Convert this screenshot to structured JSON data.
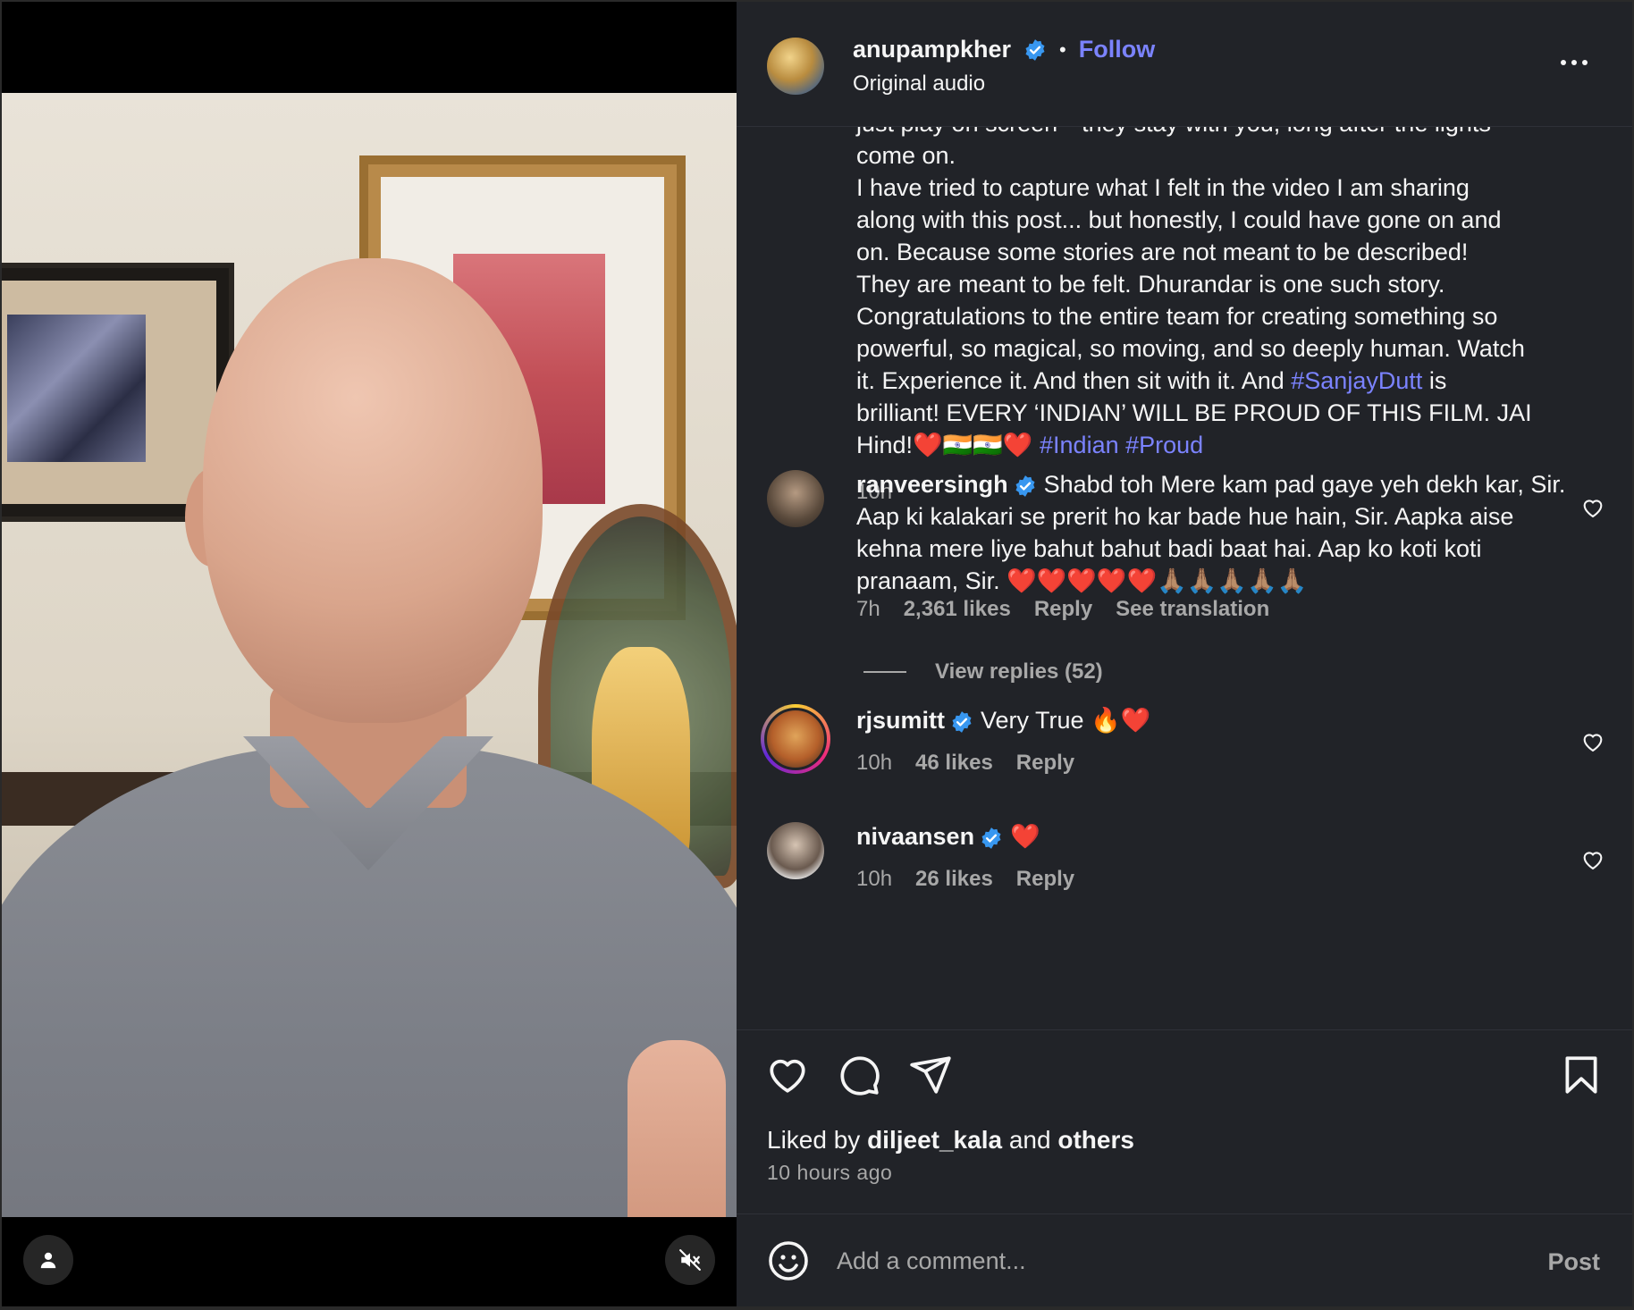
{
  "post": {
    "author": "anupampkher",
    "follow_label": "Follow",
    "separator": "•",
    "audio": "Original audio",
    "caption_lines": [
      "just play on screen—they stay with you, long after the lights",
      "come on.",
      "I have tried to capture what I felt in the video I am sharing",
      "along with this post... but honestly, I could have gone on and",
      "on. Because some stories are not meant to be described!",
      "They are meant to be felt. Dhurandar is one such story.",
      "Congratulations to the entire team for creating something so",
      "powerful, so magical, so moving, and so deeply human. Watch"
    ],
    "caption_line_9_pre": "it. Experience it. And then sit with it. And ",
    "caption_hashtag_1": "#SanjayDutt",
    "caption_line_9_post": " is",
    "caption_line_10": "brilliant! EVERY ‘INDIAN’ WILL BE PROUD OF THIS FILM. JAI",
    "caption_line_11_pre": "Hind!❤️🇮🇳🇮🇳❤️ ",
    "caption_hashtag_2": "#Indian",
    "caption_hashtag_3": "#Proud",
    "caption_time": "10h"
  },
  "comments": [
    {
      "username": "ranveersingh",
      "text": "Shabd toh Mere kam pad gaye yeh dekh kar, Sir. Aap ki kalakari se prerit ho kar bade hue hain, Sir. Aapka aise kehna mere liye bahut bahut badi baat hai. Aap ko koti koti pranaam, Sir. ❤️❤️❤️❤️❤️🙏🏽🙏🏽🙏🏽🙏🏽🙏🏽",
      "time": "7h",
      "likes": "2,361 likes",
      "reply": "Reply",
      "see_translation": "See translation",
      "view_replies": "View replies (52)"
    },
    {
      "username": "rjsumitt",
      "text": "Very True 🔥❤️",
      "time": "10h",
      "likes": "46 likes",
      "reply": "Reply"
    },
    {
      "username": "nivaansen",
      "text": "❤️",
      "time": "10h",
      "likes": "26 likes",
      "reply": "Reply"
    }
  ],
  "engagement": {
    "liked_by_prefix": "Liked by ",
    "liked_by_user": "diljeet_kala",
    "liked_by_mid": " and ",
    "liked_by_others": "others",
    "time_ago": "10 hours ago"
  },
  "comment_box": {
    "placeholder": "Add a comment...",
    "post_label": "Post"
  },
  "colors": {
    "panel_bg": "#212328",
    "link": "#7b83ff",
    "verified": "#3897f0",
    "muted_text": "#a8a8a8"
  },
  "icons": [
    "user-tag-icon",
    "muted-speaker-icon",
    "verified-icon",
    "more-options-icon",
    "heart-icon",
    "comment-icon",
    "share-icon",
    "bookmark-icon",
    "emoji-icon"
  ]
}
